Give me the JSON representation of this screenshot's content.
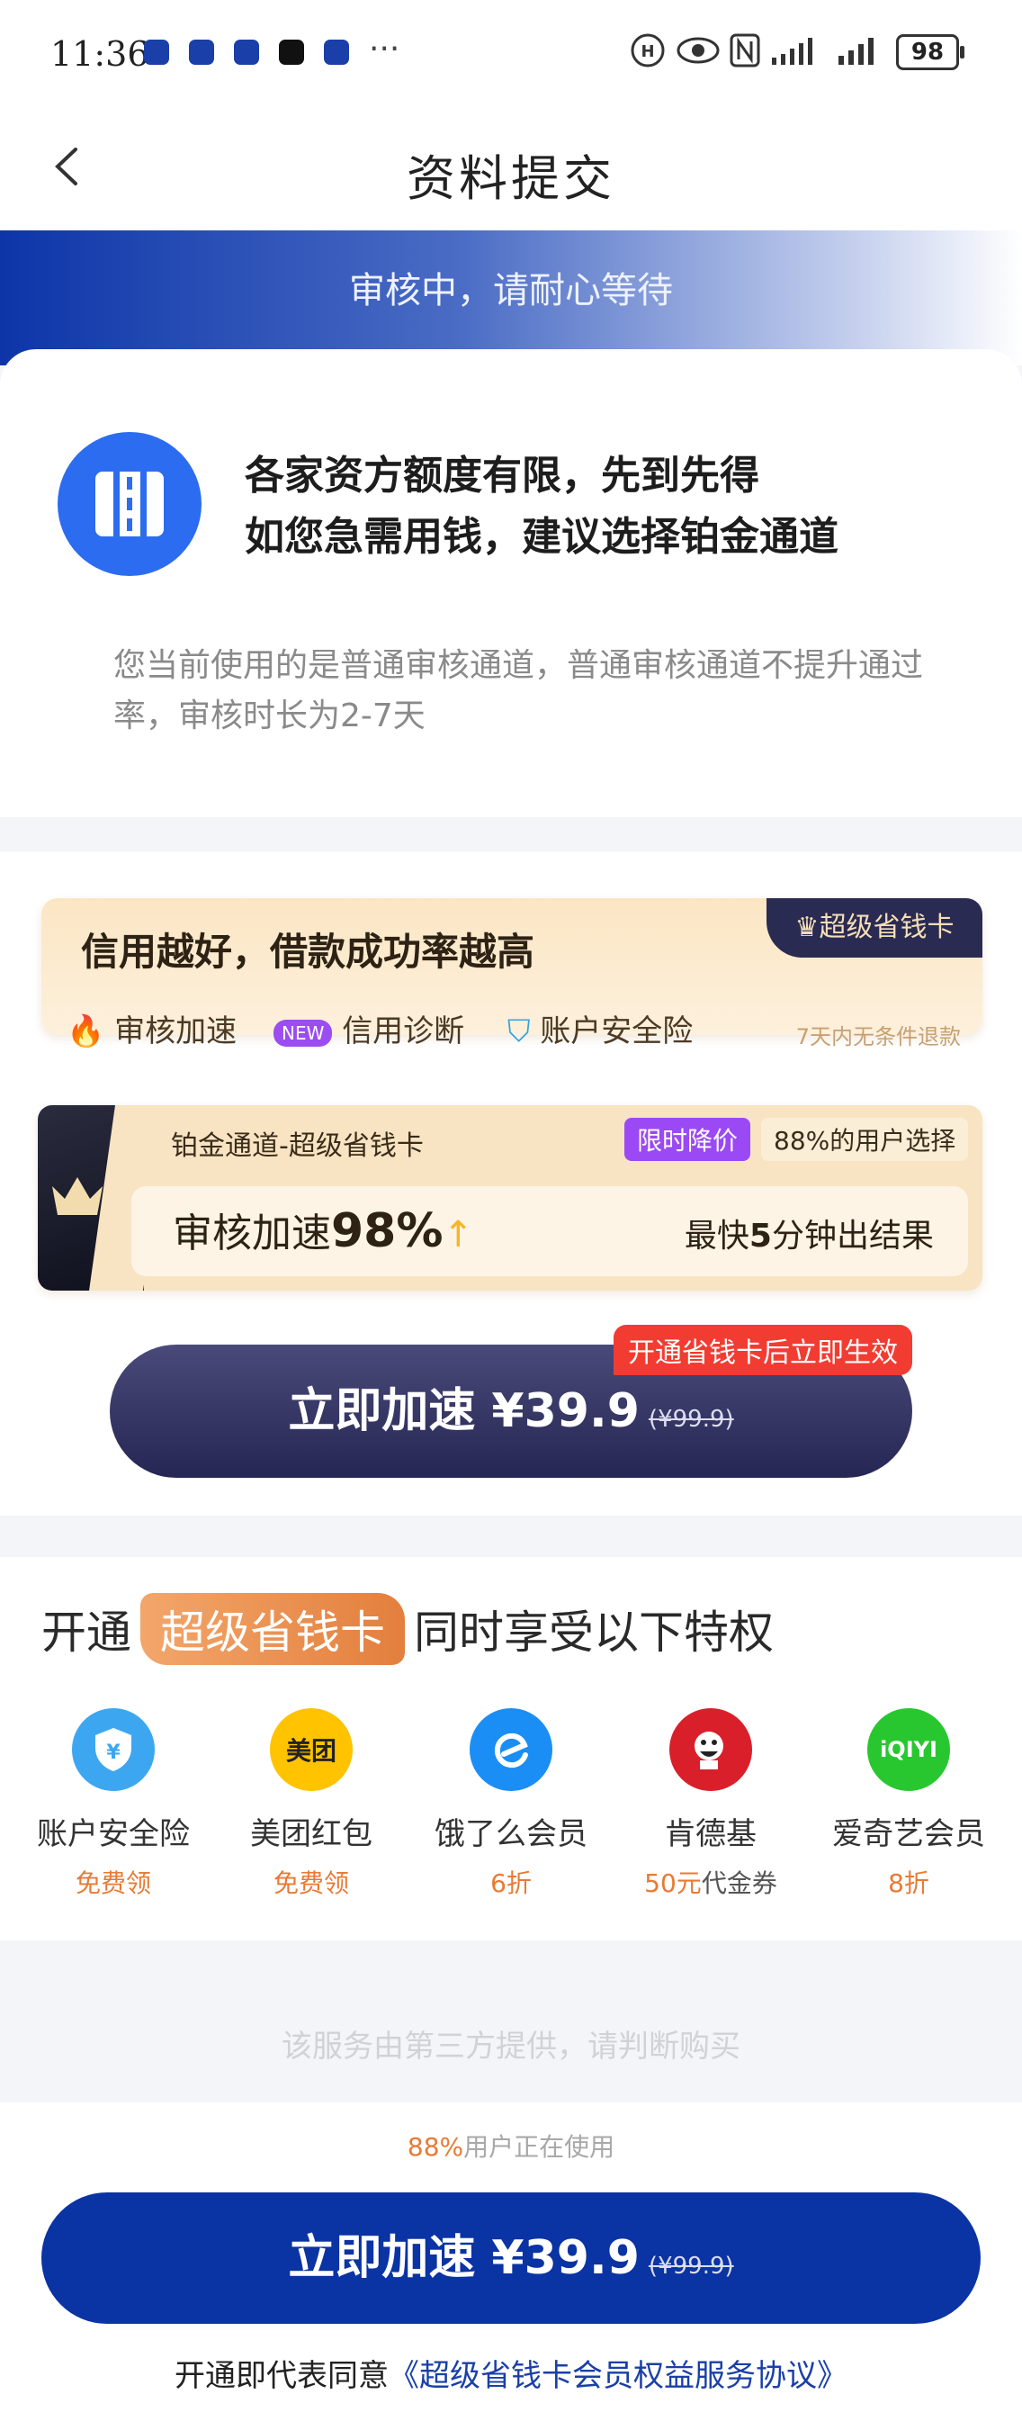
{
  "status_bar": {
    "time": "11:36",
    "more": "···",
    "battery": "98"
  },
  "nav": {
    "title": "资料提交"
  },
  "banner": {
    "text": "审核中，请耐心等待"
  },
  "info": {
    "line1": "各家资方额度有限，先到先得",
    "line2": "如您急需用钱，建议选择铂金通道",
    "desc": "您当前使用的是普通审核通道，普通审核通道不提升通过率，审核时长为2-7天"
  },
  "vip_card": {
    "badge": "超级省钱卡",
    "title": "信用越好，借款成功率越高",
    "feature1": "审核加速",
    "new_tag": "NEW",
    "feature2": "信用诊断",
    "feature3": "账户安全险",
    "refund": "7天内无条件退款"
  },
  "channel": {
    "title": "铂金通道-超级省钱卡",
    "sale_tag": "限时降价",
    "users_tag": "88%的用户选择",
    "speed_label": "审核加速",
    "speed_value": "98%",
    "fast_prefix": "最快",
    "fast_num": "5",
    "fast_suffix": "分钟出结果"
  },
  "effect_tag": "开通省钱卡后立即生效",
  "speed_button": {
    "label": "立即加速 ¥39.9",
    "original": "(¥99.9)"
  },
  "privileges": {
    "prefix": "开通",
    "pill": "超级省钱卡",
    "suffix": "同时享受以下特权",
    "items": [
      {
        "name": "账户安全险",
        "sub": "免费领"
      },
      {
        "name": "美团红包",
        "sub": "免费领",
        "icon_text": "美团"
      },
      {
        "name": "饿了么会员",
        "sub": "6折"
      },
      {
        "name": "肯德基",
        "sub_a": "50元",
        "sub_b": "代金券"
      },
      {
        "name": "爱奇艺会员",
        "sub": "8折",
        "icon_text": "iQIYI"
      }
    ]
  },
  "third_party": "该服务由第三方提供，请判断购买",
  "footer": {
    "users_pct": "88%",
    "users_text": "用户正在使用",
    "button_label": "立即加速 ¥39.9",
    "button_original": "(¥99.9)",
    "agree_prefix": "开通即代表同意",
    "agree_link": "《超级省钱卡会员权益服务协议》"
  },
  "colors": {
    "primary": "#0a33a3",
    "accent_orange": "#e87a34",
    "sale_purple": "#9b49f5",
    "tag_red": "#f23c32"
  }
}
